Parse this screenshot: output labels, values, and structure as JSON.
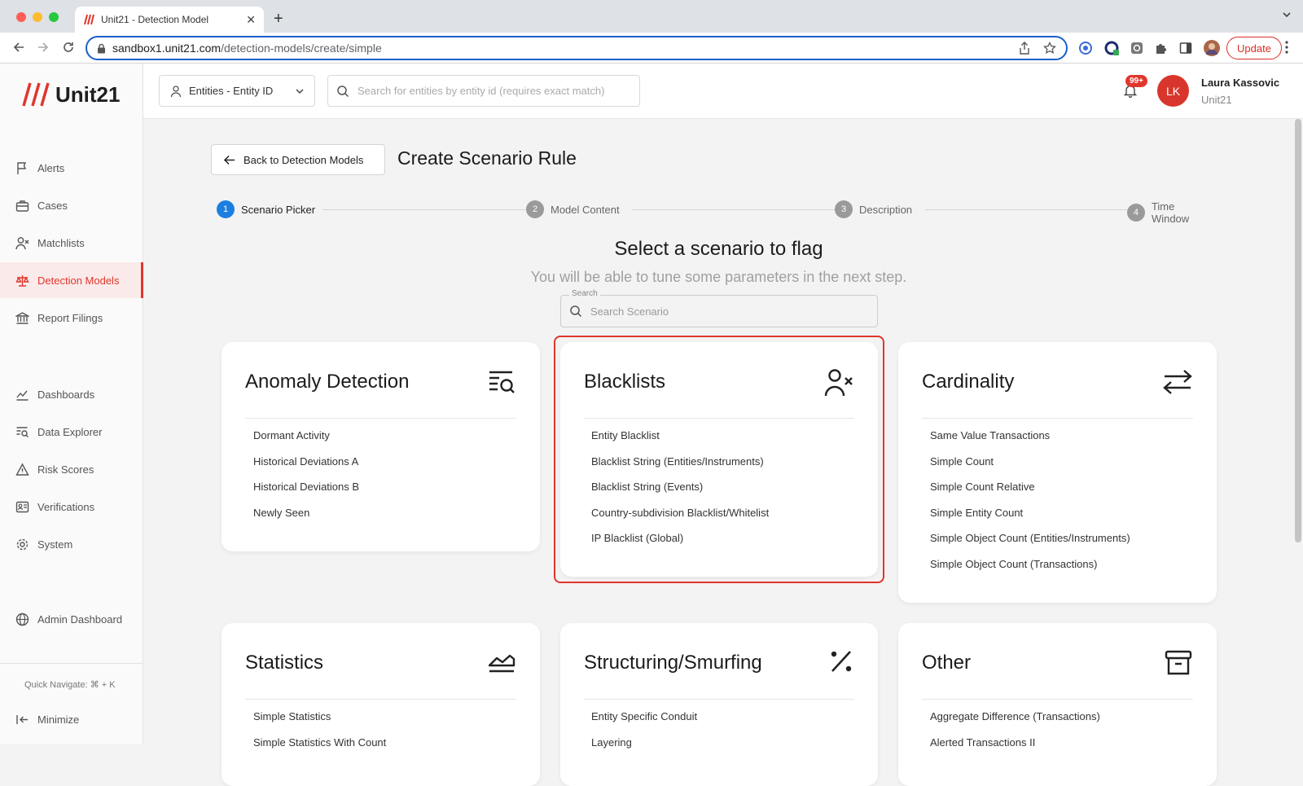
{
  "browser": {
    "tab_title": "Unit21 - Detection Model",
    "url_host": "sandbox1.unit21.com",
    "url_path": "/detection-models/create/simple",
    "update_label": "Update"
  },
  "sidebar": {
    "logo": "Unit21",
    "items": [
      {
        "label": "Alerts",
        "icon": "flag-icon"
      },
      {
        "label": "Cases",
        "icon": "briefcase-icon"
      },
      {
        "label": "Matchlists",
        "icon": "user-x-icon"
      },
      {
        "label": "Detection Models",
        "icon": "scale-icon"
      },
      {
        "label": "Report Filings",
        "icon": "bank-icon"
      },
      {
        "label": "Dashboards",
        "icon": "chart-icon"
      },
      {
        "label": "Data Explorer",
        "icon": "list-search-icon"
      },
      {
        "label": "Risk Scores",
        "icon": "warning-icon"
      },
      {
        "label": "Verifications",
        "icon": "id-card-icon"
      },
      {
        "label": "System",
        "icon": "gear-icon"
      },
      {
        "label": "Admin Dashboard",
        "icon": "globe-icon"
      }
    ],
    "quick_navigate": "Quick Navigate: ⌘ + K",
    "minimize": "Minimize"
  },
  "topbar": {
    "entity_select": "Entities - Entity ID",
    "search_placeholder": "Search for entities by entity id (requires exact match)",
    "notif_badge": "99+",
    "avatar_initials": "LK",
    "user_name": "Laura Kassovic",
    "user_org": "Unit21"
  },
  "page": {
    "back_label": "Back to Detection Models",
    "title": "Create Scenario Rule",
    "steps": [
      {
        "num": "1",
        "label": "Scenario Picker"
      },
      {
        "num": "2",
        "label": "Model Content"
      },
      {
        "num": "3",
        "label": "Description"
      },
      {
        "num": "4",
        "label": "Time Window"
      }
    ],
    "heading": "Select a scenario to flag",
    "subheading": "You will be able to tune some parameters in the next step.",
    "search_label": "Search",
    "search_placeholder": "Search Scenario"
  },
  "cards": [
    {
      "title": "Anomaly Detection",
      "icon": "list-search-icon",
      "items": [
        "Dormant Activity",
        "Historical Deviations A",
        "Historical Deviations B",
        "Newly Seen"
      ]
    },
    {
      "title": "Blacklists",
      "icon": "user-x-icon",
      "items": [
        "Entity Blacklist",
        "Blacklist String (Entities/Instruments)",
        "Blacklist String (Events)",
        "Country-subdivision Blacklist/Whitelist",
        "IP Blacklist (Global)"
      ]
    },
    {
      "title": "Cardinality",
      "icon": "arrows-swap-icon",
      "items": [
        "Same Value Transactions",
        "Simple Count",
        "Simple Count Relative",
        "Simple Entity Count",
        "Simple Object Count (Entities/Instruments)",
        "Simple Object Count (Transactions)"
      ]
    },
    {
      "title": "Statistics",
      "icon": "area-chart-icon",
      "items": [
        "Simple Statistics",
        "Simple Statistics With Count"
      ]
    },
    {
      "title": "Structuring/Smurfing",
      "icon": "percent-icon",
      "items": [
        "Entity Specific Conduit",
        "Layering"
      ]
    },
    {
      "title": "Other",
      "icon": "archive-icon",
      "items": [
        "Aggregate Difference (Transactions)",
        "Alerted Transactions II"
      ]
    }
  ],
  "colors": {
    "accent": "#e0362c",
    "step_active": "#1c7fe0",
    "background": "#f3f3f4"
  }
}
